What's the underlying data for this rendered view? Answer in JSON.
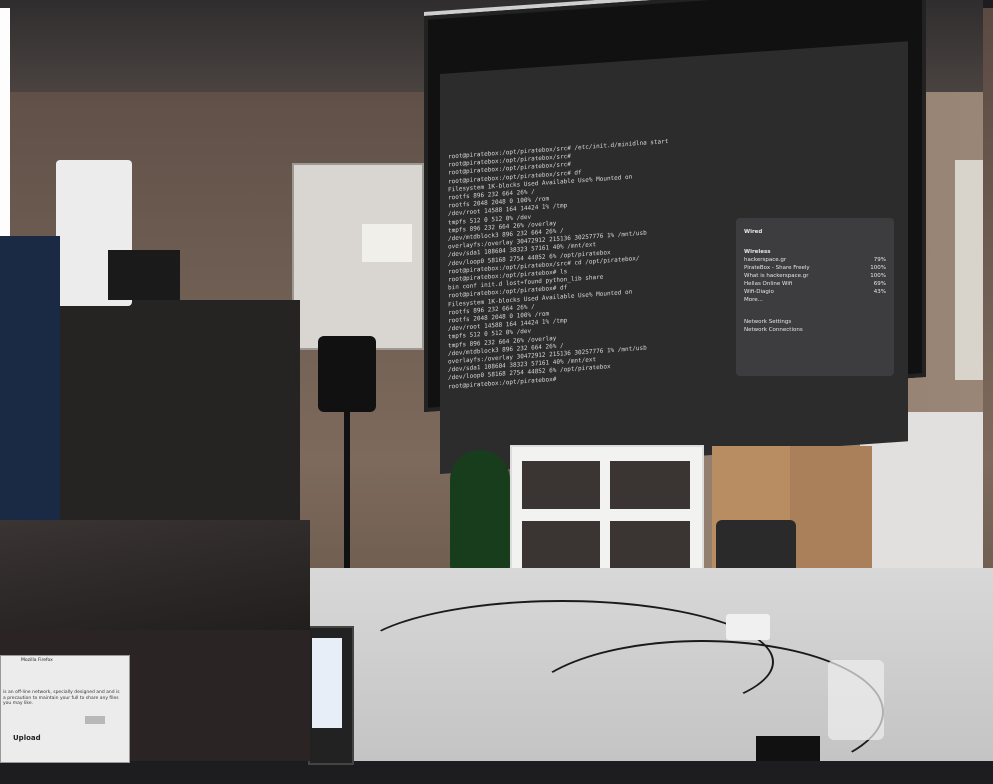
{
  "scene": {
    "description_type": "photo-collage",
    "accent_colors": {
      "screen_bg": "#2c2c2c",
      "wall": "#7d6a5c",
      "table": "#d0d0d0"
    }
  },
  "projector": {
    "terminal_lines": [
      "root@piratebox:/opt/piratebox/src# /etc/init.d/minidlna start",
      "root@piratebox:/opt/piratebox/src#",
      "root@piratebox:/opt/piratebox/src#",
      "root@piratebox:/opt/piratebox/src# df",
      "Filesystem           1K-blocks      Used Available Use% Mounted on",
      "rootfs                     896       232       664  26% /",
      "rootfs                    2048      2048         0 100% /rom",
      "/dev/root                14588       164     14424   1% /tmp",
      "tmpfs                      512         0       512   0% /dev",
      "tmpfs                      896       232       664  26% /overlay",
      "/dev/mtdblock3             896       232       664  26% /",
      "overlayfs:/overlay    30472912    215136  30257776   1% /mnt/usb",
      "/dev/sda1               108604     38323     57161  40% /mnt/ext",
      "/dev/loop0               58168      2754     44852   6% /opt/piratebox",
      "root@piratebox:/opt/piratebox/src# cd /opt/piratebox/",
      "root@piratebox:/opt/piratebox# ls",
      "bin      conf     init.d   lost+found  python_lib  share",
      "root@piratebox:/opt/piratebox# df",
      "Filesystem           1K-blocks      Used Available Use% Mounted on",
      "rootfs                     896       232       664  26% /",
      "rootfs                    2048      2048         0 100% /rom",
      "/dev/root                14588       164     14424   1% /tmp",
      "tmpfs                      512         0       512   0% /dev",
      "tmpfs                      896       232       664  26% /overlay",
      "/dev/mtdblock3             896       232       664  26% /",
      "overlayfs:/overlay    30472912    215136  30257776   1% /mnt/usb",
      "/dev/sda1               108604     38323     57161  40% /mnt/ext",
      "/dev/loop0               58168      2754     44852   6% /opt/piratebox",
      "root@piratebox:/opt/piratebox#"
    ],
    "wifi_panel": {
      "title": "Wired",
      "section": "Wireless",
      "networks": [
        {
          "name": "hackerspace.gr",
          "signal": "79%"
        },
        {
          "name": "PirateBox - Share Freely",
          "signal": "100%"
        },
        {
          "name": "What is hackerspace.gr",
          "signal": "100%"
        },
        {
          "name": "Hellas Online Wifi",
          "signal": "69%"
        },
        {
          "name": "Wifi-Diagio",
          "signal": "43%"
        }
      ],
      "more": "More...",
      "settings": "Network Settings",
      "connections": "Network Connections"
    }
  },
  "inset_browser": {
    "title": "Mozilla Firefox",
    "body": "is an off-line network, specially designed and and is a precaution to maintain your full to share any files you may like.",
    "upload_heading": "Upload"
  }
}
